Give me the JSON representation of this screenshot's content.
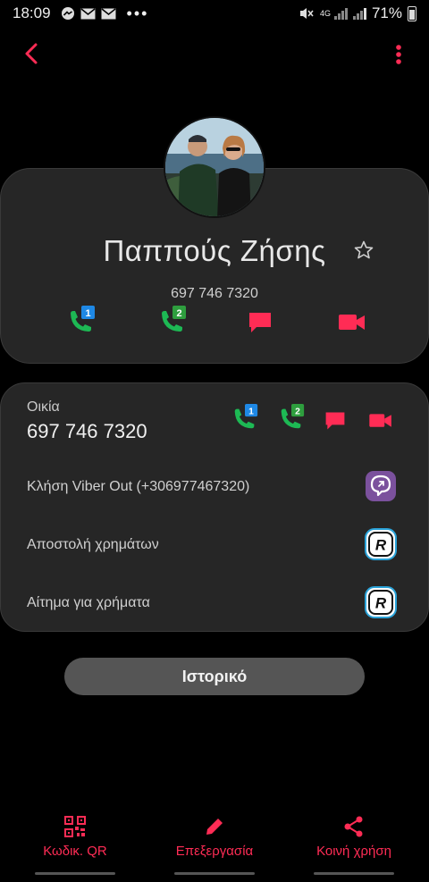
{
  "status_bar": {
    "time": "18:09",
    "network": "4G",
    "battery": "71%"
  },
  "contact": {
    "name": "Παππούς Ζήσης",
    "phone": "697 746 7320"
  },
  "home": {
    "label": "Οικία",
    "number": "697 746 7320"
  },
  "sim_labels": {
    "sim1": "1",
    "sim2": "2"
  },
  "rows": [
    {
      "label": "Κλήση Viber Out (+306977467320)"
    },
    {
      "label": "Αποστολή χρημάτων"
    },
    {
      "label": "Αίτημα για χρήματα"
    }
  ],
  "history_button": "Ιστορικό",
  "bottom_nav": {
    "qr": "Κωδικ. QR",
    "edit": "Επεξεργασία",
    "share": "Κοινή χρήση"
  },
  "colors": {
    "accent": "#ff2c55",
    "call_green": "#1db954",
    "sim1_blue": "#1e88e5",
    "sim2_green": "#2e9e3e",
    "viber": "#7b519d"
  }
}
